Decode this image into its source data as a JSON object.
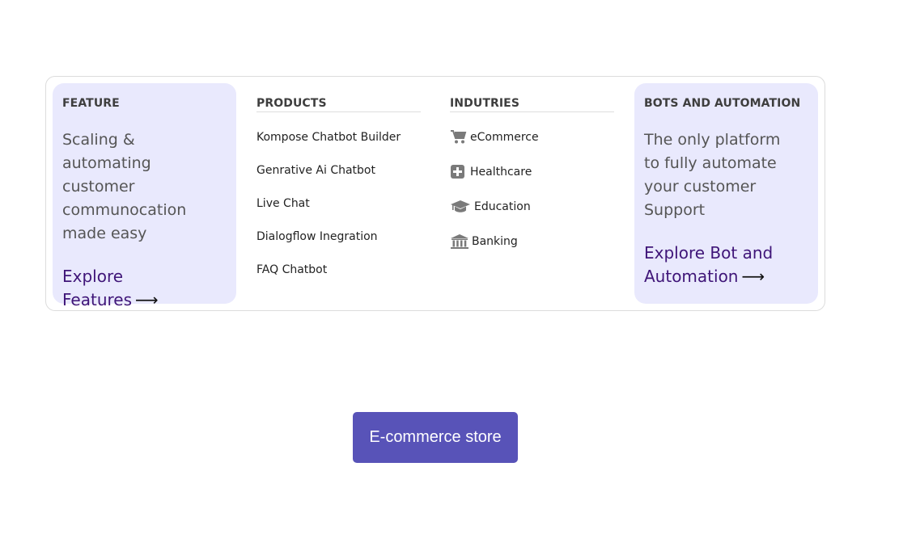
{
  "menu": {
    "feature": {
      "heading": "FEATURE",
      "text": "Scaling & automating customer communocation made easy",
      "link_label": "Explore Features",
      "arrow": "⟶"
    },
    "products": {
      "heading": "PRODUCTS",
      "items": [
        {
          "label": "Kompose Chatbot Builder"
        },
        {
          "label": "Genrative Ai Chatbot"
        },
        {
          "label": "Live Chat"
        },
        {
          "label": "Dialogflow Inegration"
        },
        {
          "label": "FAQ Chatbot"
        }
      ]
    },
    "industries": {
      "heading": "INDUTRIES",
      "items": [
        {
          "label": "eCommerce",
          "icon": "shopping-cart-icon"
        },
        {
          "label": "Healthcare",
          "icon": "plus-square-icon"
        },
        {
          "label": "Education",
          "icon": "graduation-cap-icon"
        },
        {
          "label": "Banking",
          "icon": "bank-icon"
        }
      ]
    },
    "bots": {
      "heading": "BOTS AND AUTOMATION",
      "text": "The only platform to fully automate your customer Support",
      "link_label": "Explore Bot and Automation",
      "arrow": "⟶"
    }
  },
  "cta": {
    "label": "E-commerce store"
  },
  "colors": {
    "panel_bg": "#e9e9fd",
    "link": "#3f1578",
    "button": "#5853b8",
    "icon_gray": "#7a7a7a"
  }
}
